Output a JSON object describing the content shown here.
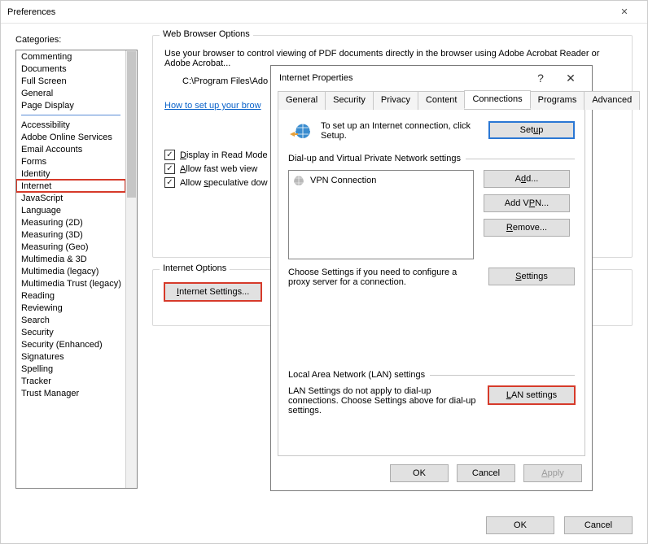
{
  "prefs": {
    "title": "Preferences",
    "categories_label": "Categories:",
    "categories_group1": [
      "Commenting",
      "Documents",
      "Full Screen",
      "General",
      "Page Display"
    ],
    "categories_group2": [
      "Accessibility",
      "Adobe Online Services",
      "Email Accounts",
      "Forms",
      "Identity",
      "Internet",
      "JavaScript",
      "Language",
      "Measuring (2D)",
      "Measuring (3D)",
      "Measuring (Geo)",
      "Multimedia & 3D",
      "Multimedia (legacy)",
      "Multimedia Trust (legacy)",
      "Reading",
      "Reviewing",
      "Search",
      "Security",
      "Security (Enhanced)",
      "Signatures",
      "Spelling",
      "Tracker",
      "Trust Manager"
    ],
    "selected_category": "Internet",
    "web_browser_group": "Web Browser Options",
    "browser_desc": "Use your browser to control viewing of PDF documents directly in the browser using Adobe Acrobat Reader or Adobe Acrobat...",
    "program_path": "C:\\Program Files\\Ado",
    "howto_link": "How to set up your brow",
    "check_read_mode": "Display in Read Mode",
    "check_fast_web": "Allow fast web view",
    "check_speculative": "Allow speculative dow",
    "internet_options_group": "Internet Options",
    "internet_settings_btn": "Internet Settings...",
    "ok": "OK",
    "cancel": "Cancel"
  },
  "inet": {
    "title": "Internet Properties",
    "tabs": [
      "General",
      "Security",
      "Privacy",
      "Content",
      "Connections",
      "Programs",
      "Advanced"
    ],
    "active_tab": "Connections",
    "setup_text": "To set up an Internet connection, click Setup.",
    "setup_btn": "Setup",
    "dialup_label": "Dial-up and Virtual Private Network settings",
    "vpn_entry": "VPN Connection",
    "add_btn": "Add...",
    "add_vpn_btn": "Add VPN...",
    "remove_btn": "Remove...",
    "settings_btn": "Settings",
    "proxy_text": "Choose Settings if you need to configure a proxy server for a connection.",
    "lan_label": "Local Area Network (LAN) settings",
    "lan_text": "LAN Settings do not apply to dial-up connections. Choose Settings above for dial-up settings.",
    "lan_btn": "LAN settings",
    "ok": "OK",
    "cancel": "Cancel",
    "apply": "Apply"
  }
}
